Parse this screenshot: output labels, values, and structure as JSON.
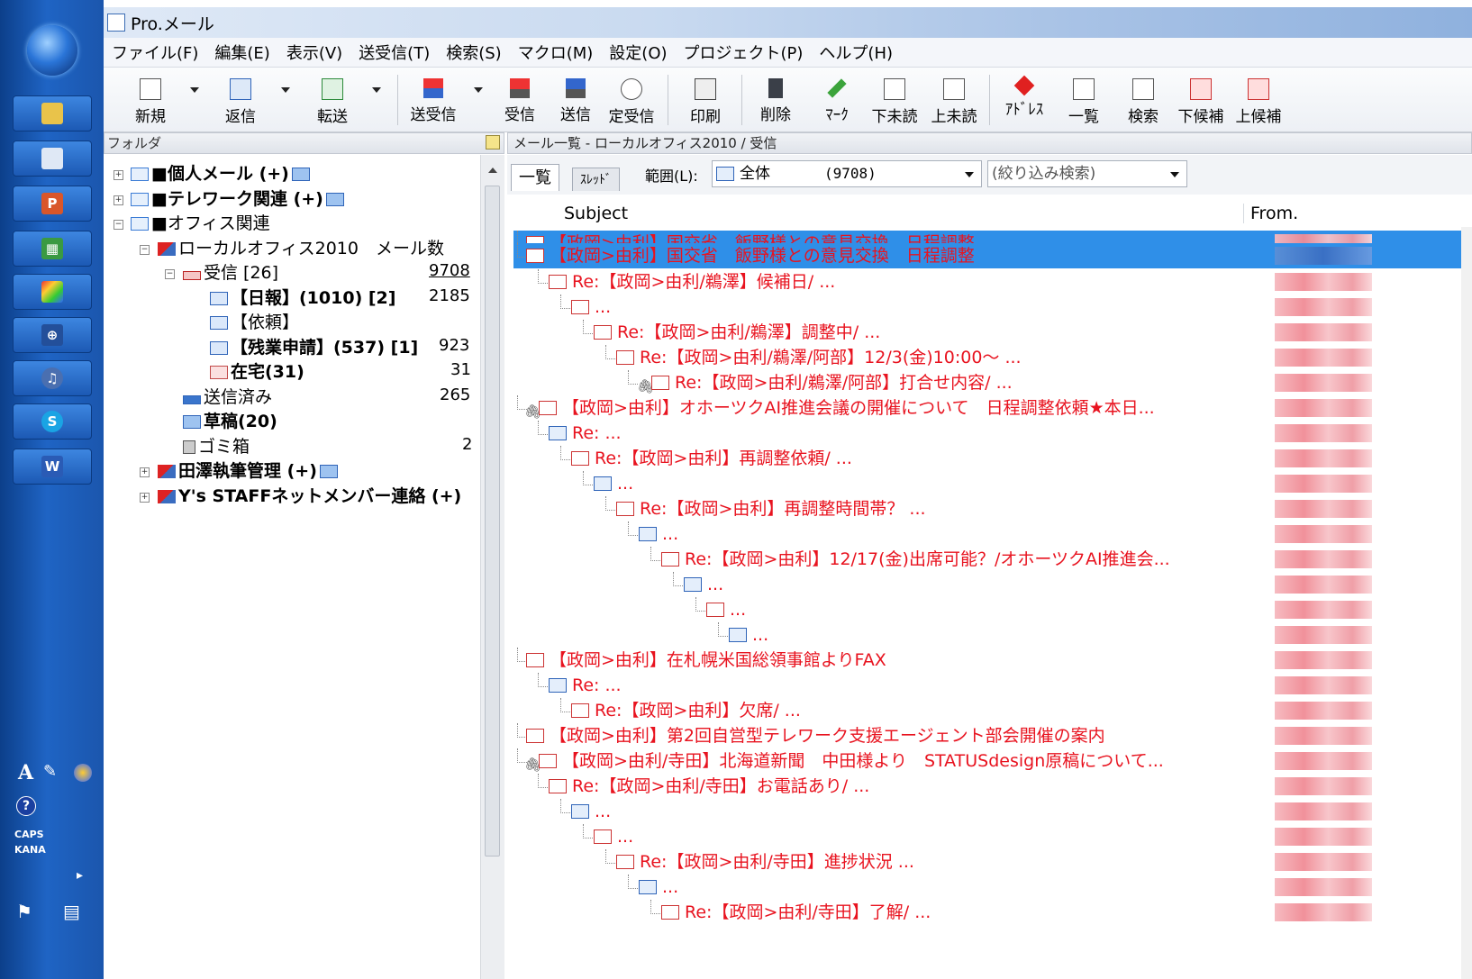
{
  "window": {
    "title": "Pro.メール"
  },
  "menu": [
    "ファイル(F)",
    "編集(E)",
    "表示(V)",
    "送受信(T)",
    "検索(S)",
    "マクロ(M)",
    "設定(O)",
    "プロジェクト(P)",
    "ヘルプ(H)"
  ],
  "toolbar": {
    "new": "新規",
    "reply": "返信",
    "forward": "転送",
    "sendrecv": "送受信",
    "receive": "受信",
    "send": "送信",
    "scheduled": "定受信",
    "print": "印刷",
    "delete": "削除",
    "mark": "ﾏｰｸ",
    "next_unread": "下未読",
    "prev_unread": "上未読",
    "address": "ｱﾄﾞﾚｽ",
    "list": "一覧",
    "search": "検索",
    "next_cand": "下候補",
    "prev_cand": "上候補"
  },
  "folder_pane": {
    "header": "フォルダ",
    "nodes": [
      {
        "label": "■個人メール (+)"
      },
      {
        "label": "■テレワーク関連 (+)"
      },
      {
        "label": "■オフィス関連"
      },
      {
        "label": "ローカルオフィス2010　メール数"
      },
      {
        "label": "受信 [26]",
        "count": "9708"
      },
      {
        "label": "【日報】(1010) [2]",
        "count": "2185"
      },
      {
        "label": "【依頼】",
        "count": ""
      },
      {
        "label": "【残業申請】(537) [1]",
        "count": "923"
      },
      {
        "label": "在宅(31)",
        "count": "31"
      },
      {
        "label": "送信済み",
        "count": "265"
      },
      {
        "label": "草稿(20)",
        "count": ""
      },
      {
        "label": "ゴミ箱",
        "count": "2"
      },
      {
        "label": "田澤執筆管理 (+)"
      },
      {
        "label": "Y's STAFFネットメンバー連絡 (+)"
      }
    ]
  },
  "mail_pane": {
    "header": "メール一覧 - ローカルオフィス2010 / 受信",
    "tab_list": "一覧",
    "tab_thread": "ｽﾚｯﾄﾞ",
    "range_label": "範囲(L):",
    "range_value": "全体",
    "range_count": "(9708)",
    "filter_placeholder": "(絞り込み検索)",
    "col_subject": "Subject",
    "col_from": "From.",
    "rows": [
      "【政岡>由利】国交省　飯野様との意見交換　日程調整",
      "【政岡>由利】国交省　飯野様との意見交換　日程調整",
      "Re:【政岡>由利/鵜澤】候補日/ ...",
      "...",
      "Re:【政岡>由利/鵜澤】調整中/ ...",
      "Re:【政岡>由利/鵜澤/阿部】12/3(金)10:00～ ...",
      "Re:【政岡>由利/鵜澤/阿部】打合せ内容/ ...",
      "【政岡>由利】オホーツクAI推進会議の開催について　日程調整依頼★本日...",
      "Re: ...",
      "Re:【政岡>由利】再調整依頼/ ...",
      "...",
      "Re:【政岡>由利】再調整時間帯？ ...",
      "...",
      "Re:【政岡>由利】12/17(金)出席可能？/オホーツクAI推進会...",
      "...",
      "...",
      "...",
      "【政岡>由利】在札幌米国総領事館よりFAX",
      "Re: ...",
      "Re:【政岡>由利】欠席/ ...",
      "【政岡>由利】第2回自営型テレワーク支援エージェント部会開催の案内",
      "【政岡>由利/寺田】北海道新聞　中田様より　STATUSdesign原稿について...",
      "Re:【政岡>由利/寺田】お電話あり/ ...",
      "...",
      "...",
      "Re:【政岡>由利/寺田】進捗状況 ...",
      "...",
      "Re:【政岡>由利/寺田】了解/ ..."
    ]
  },
  "launcher": {
    "caps": "CAPS",
    "kana": "KANA"
  }
}
